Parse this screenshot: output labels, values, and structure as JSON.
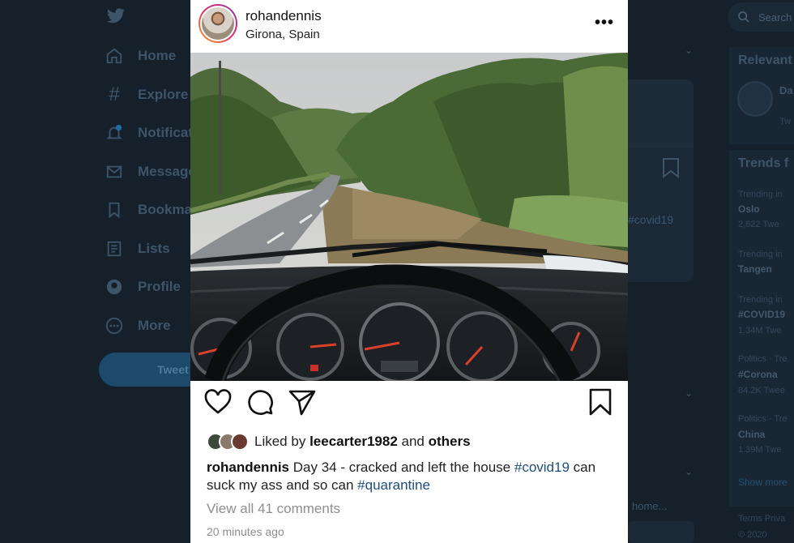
{
  "background": {
    "nav": [
      {
        "label": "Home",
        "icon": "home-icon"
      },
      {
        "label": "Explore",
        "icon": "hashtag-icon"
      },
      {
        "label": "Notifications",
        "icon": "bell-icon"
      },
      {
        "label": "Messages",
        "icon": "mail-icon"
      },
      {
        "label": "Bookmarks",
        "icon": "bookmark-icon"
      },
      {
        "label": "Lists",
        "icon": "list-icon"
      },
      {
        "label": "Profile",
        "icon": "profile-icon"
      },
      {
        "label": "More",
        "icon": "more-circle-icon"
      }
    ],
    "tweet_button": "Tweet",
    "card_hashtag": "#covid19",
    "home_link": "home...",
    "search_placeholder": "Search",
    "relevant_title": "Relevant",
    "relevant_name": "Da",
    "relevant_sub": "Tw",
    "trends_title": "Trends f",
    "trends": [
      {
        "context": "Trending in",
        "name": "Oslo",
        "count": "2,622 Twe"
      },
      {
        "context": "Trending in",
        "name": "Tangen",
        "count": ""
      },
      {
        "context": "Trending in",
        "name": "#COVID19",
        "count": "1.34M Twe"
      },
      {
        "context": "Politics · Tre",
        "name": "#Corona",
        "count": "84.2K Twee"
      },
      {
        "context": "Politics · Tre",
        "name": "China",
        "count": "1.39M Twe"
      }
    ],
    "show_more": "Show more",
    "footer": "Terms  Priva",
    "copyright": "© 2020"
  },
  "post": {
    "username": "rohandennis",
    "location": "Girona, Spain",
    "more_label": "•••",
    "liked_prefix": "Liked by",
    "liked_user": "leecarter1982",
    "liked_and": "and",
    "liked_others": "others",
    "caption_user": "rohandennis",
    "caption_text_1": "Day 34 - cracked and left the house",
    "caption_tag_1": "#covid19",
    "caption_text_2": "can suck my ass and so can",
    "caption_tag_2": "#quarantine",
    "comments_link": "View all 41 comments",
    "time": "20 minutes ago"
  },
  "colors": {
    "twitter_bg": "#15202b",
    "hashtag": "#1e4d7a",
    "muted": "#8e8e8e"
  }
}
